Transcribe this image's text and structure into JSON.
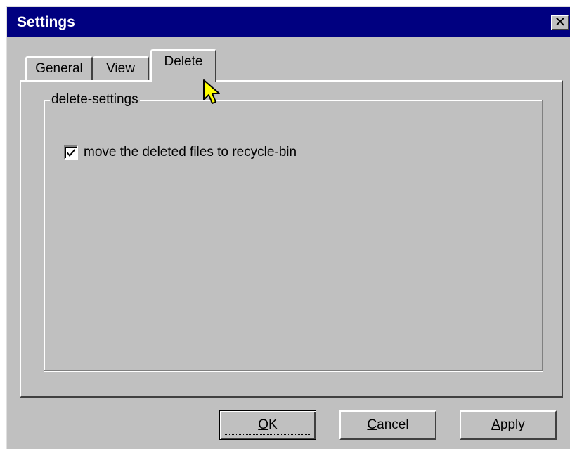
{
  "window": {
    "title": "Settings",
    "close_glyph": "✕"
  },
  "tabs": [
    {
      "label": "General",
      "active": false
    },
    {
      "label": "View",
      "active": false
    },
    {
      "label": "Delete",
      "active": true
    }
  ],
  "group": {
    "legend": "delete-settings",
    "checkbox": {
      "label": "move the deleted files to recycle-bin",
      "checked": true
    }
  },
  "buttons": {
    "ok": "OK",
    "cancel": "Cancel",
    "apply": "Apply"
  },
  "colors": {
    "titlebar": "#000080",
    "face": "#c0c0c0",
    "cursor": "#ffff00"
  },
  "icons": {
    "close": "close-icon",
    "check": "checkmark-icon",
    "cursor": "mouse-pointer-icon"
  }
}
